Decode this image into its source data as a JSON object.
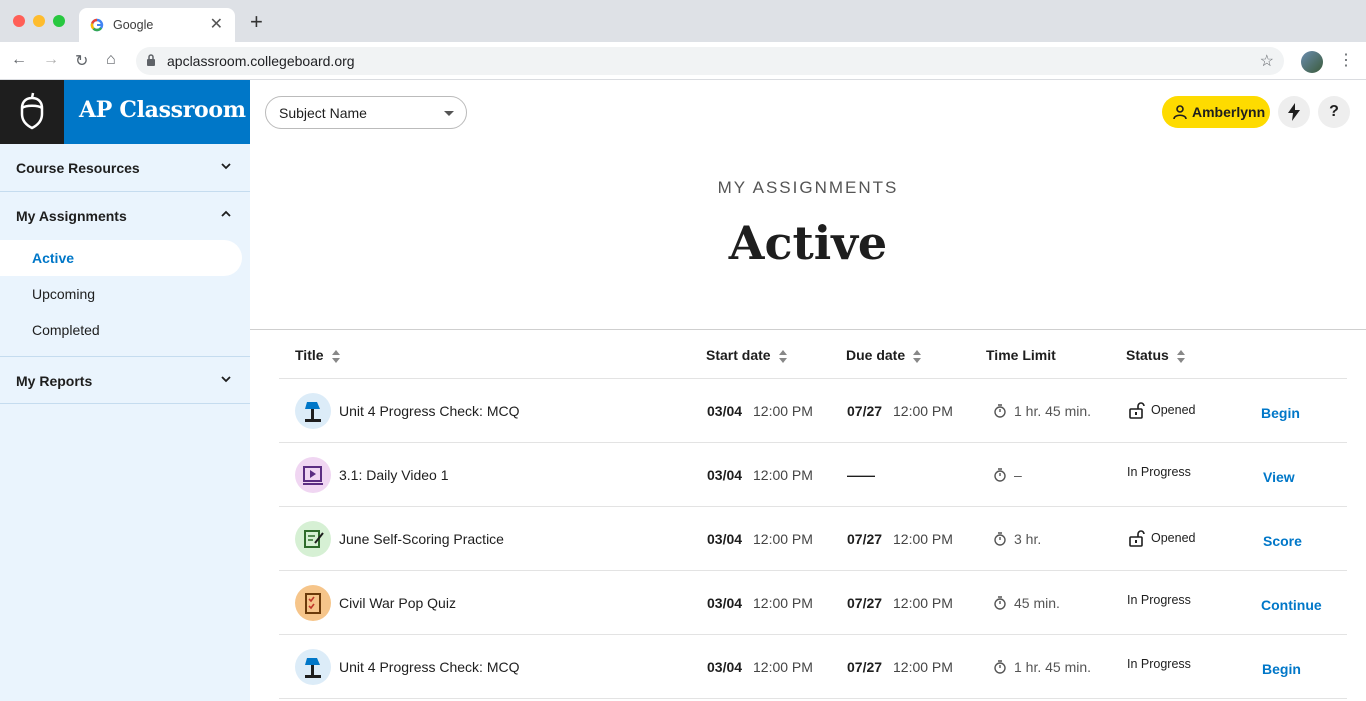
{
  "browser": {
    "tab_title": "Google",
    "url": "apclassroom.collegeboard.org",
    "new_tab": "+",
    "close_tab": "✕"
  },
  "sidebar": {
    "brand": "AP Classroom",
    "sections": [
      {
        "label": "Course Resources",
        "expanded": false
      },
      {
        "label": "My Assignments",
        "expanded": true
      },
      {
        "label": "My Reports",
        "expanded": false
      }
    ],
    "sub_items": [
      {
        "label": "Active",
        "selected": true
      },
      {
        "label": "Upcoming",
        "selected": false
      },
      {
        "label": "Completed",
        "selected": false
      }
    ]
  },
  "header": {
    "subject_select": "Subject Name",
    "user_name": "Amberlynn",
    "help": "?"
  },
  "page": {
    "eyebrow": "MY ASSIGNMENTS",
    "title": "Active"
  },
  "table": {
    "columns": [
      "Title",
      "Start date",
      "Due date",
      "Time Limit",
      "Status"
    ],
    "rows": [
      {
        "icon": "lamp-icon",
        "title": "Unit 4 Progress Check: MCQ",
        "start_date": "03/04",
        "start_time": "12:00 PM",
        "due_date": "07/27",
        "due_time": "12:00 PM",
        "time_limit": "1 hr. 45 min.",
        "status": "Opened",
        "action": "Begin"
      },
      {
        "icon": "video-icon",
        "title": "3.1: Daily Video 1",
        "start_date": "03/04",
        "start_time": "12:00 PM",
        "due_date": "——",
        "due_time": "",
        "time_limit": "–",
        "status": "In Progress",
        "action": "View"
      },
      {
        "icon": "notepad-icon",
        "title": "June Self-Scoring Practice",
        "start_date": "03/04",
        "start_time": "12:00 PM",
        "due_date": "07/27",
        "due_time": "12:00 PM",
        "time_limit": "3 hr.",
        "status": "Opened",
        "action": "Score"
      },
      {
        "icon": "checklist-icon",
        "title": "Civil War Pop Quiz",
        "start_date": "03/04",
        "start_time": "12:00 PM",
        "due_date": "07/27",
        "due_time": "12:00 PM",
        "time_limit": "45 min.",
        "status": "In Progress",
        "action": "Continue"
      },
      {
        "icon": "lamp-icon",
        "title": "Unit 4 Progress Check: MCQ",
        "start_date": "03/04",
        "start_time": "12:00 PM",
        "due_date": "07/27",
        "due_time": "12:00 PM",
        "time_limit": "1 hr. 45 min.",
        "status": "In Progress",
        "action": "Begin"
      }
    ]
  },
  "colors": {
    "brand_blue": "#0077c8",
    "user_yellow": "#fedb00",
    "sidebar_bg": "#eaf4fd"
  }
}
